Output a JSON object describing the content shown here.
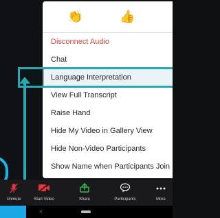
{
  "reactions": {
    "clap_icon": "clapping-hands-icon",
    "thumb_icon": "thumbs-up-icon"
  },
  "menu": {
    "items": [
      {
        "label": "Disconnect Audio"
      },
      {
        "label": "Chat"
      },
      {
        "label": "Language Interpretation"
      },
      {
        "label": "View Full Transcript"
      },
      {
        "label": "Raise Hand"
      },
      {
        "label": "Hide My Video in Gallery View"
      },
      {
        "label": "Hide Non-Video Participants"
      },
      {
        "label": "Show Name when Participants Join"
      }
    ]
  },
  "toolbar": {
    "unmute": "Unmute",
    "start_video": "Start Video",
    "share": "Share",
    "participants": "Participants",
    "more": "More"
  },
  "colors": {
    "highlight": "#28a8b3",
    "danger": "#e0443e",
    "share": "#2fc14e"
  }
}
